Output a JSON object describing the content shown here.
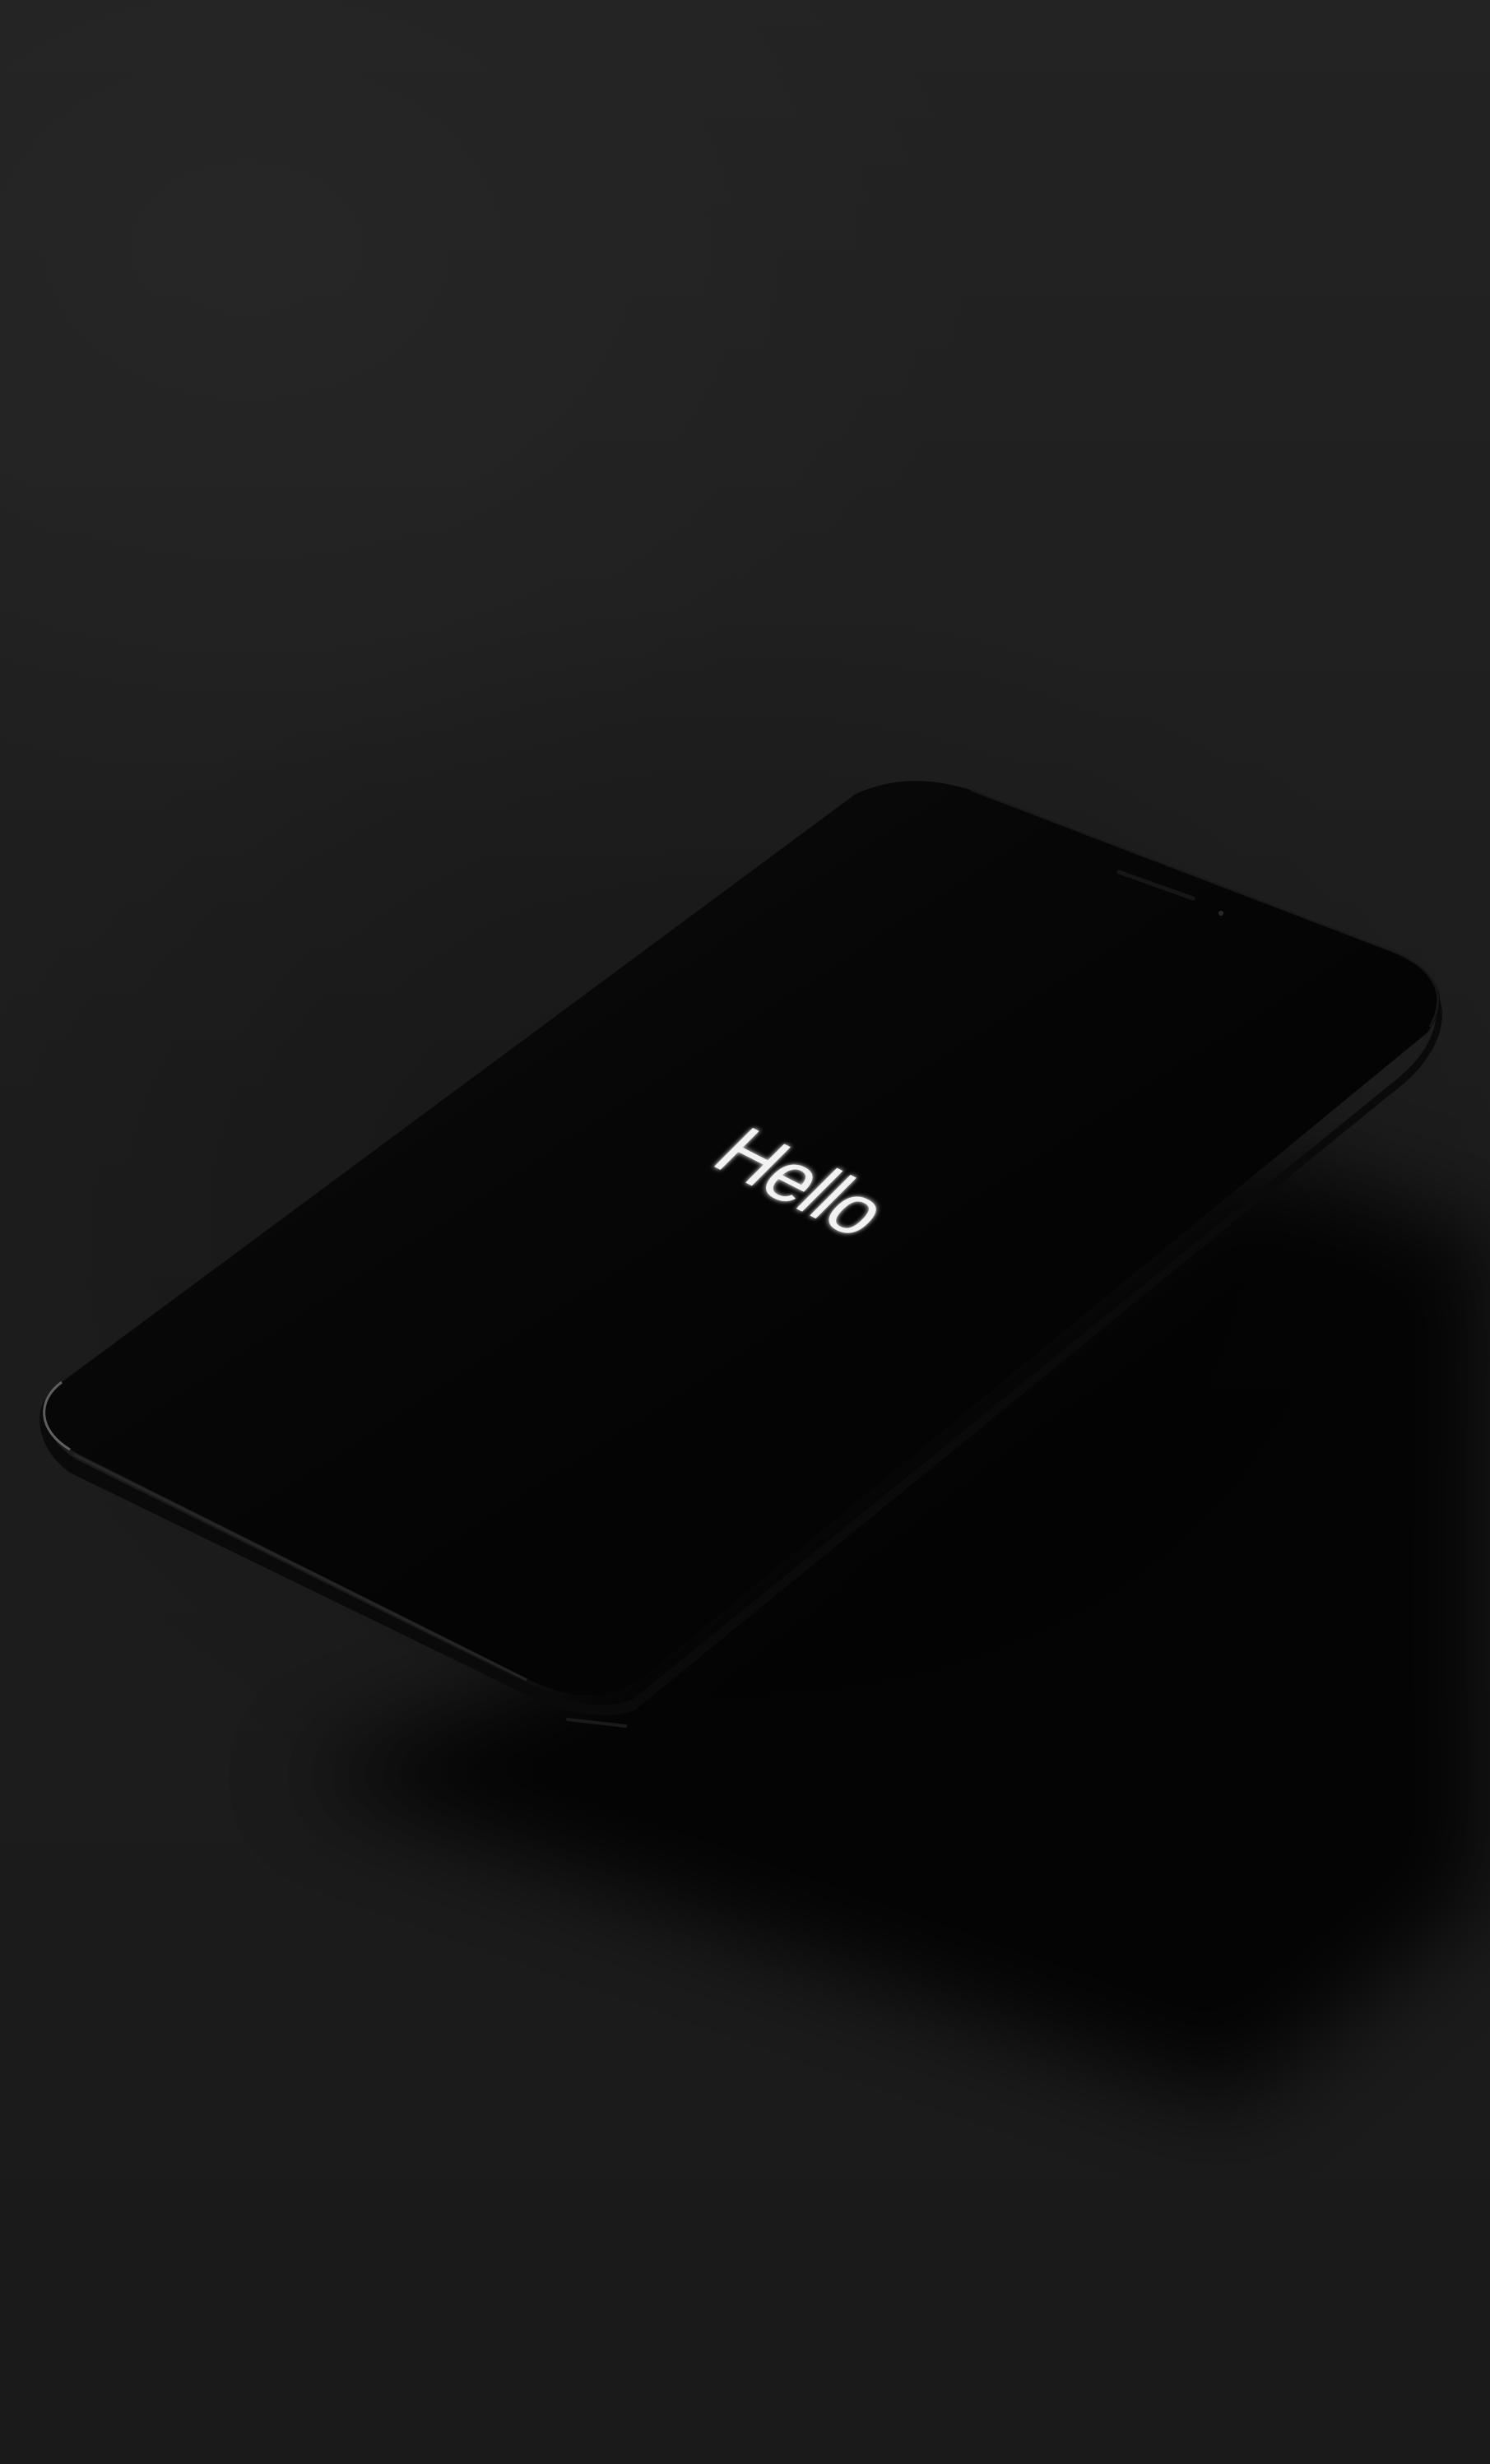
{
  "screen": {
    "text": "Hello"
  },
  "colors": {
    "background": "#1e1e1e",
    "phone_body": "#050505",
    "screen_text": "#f2f2f2"
  }
}
